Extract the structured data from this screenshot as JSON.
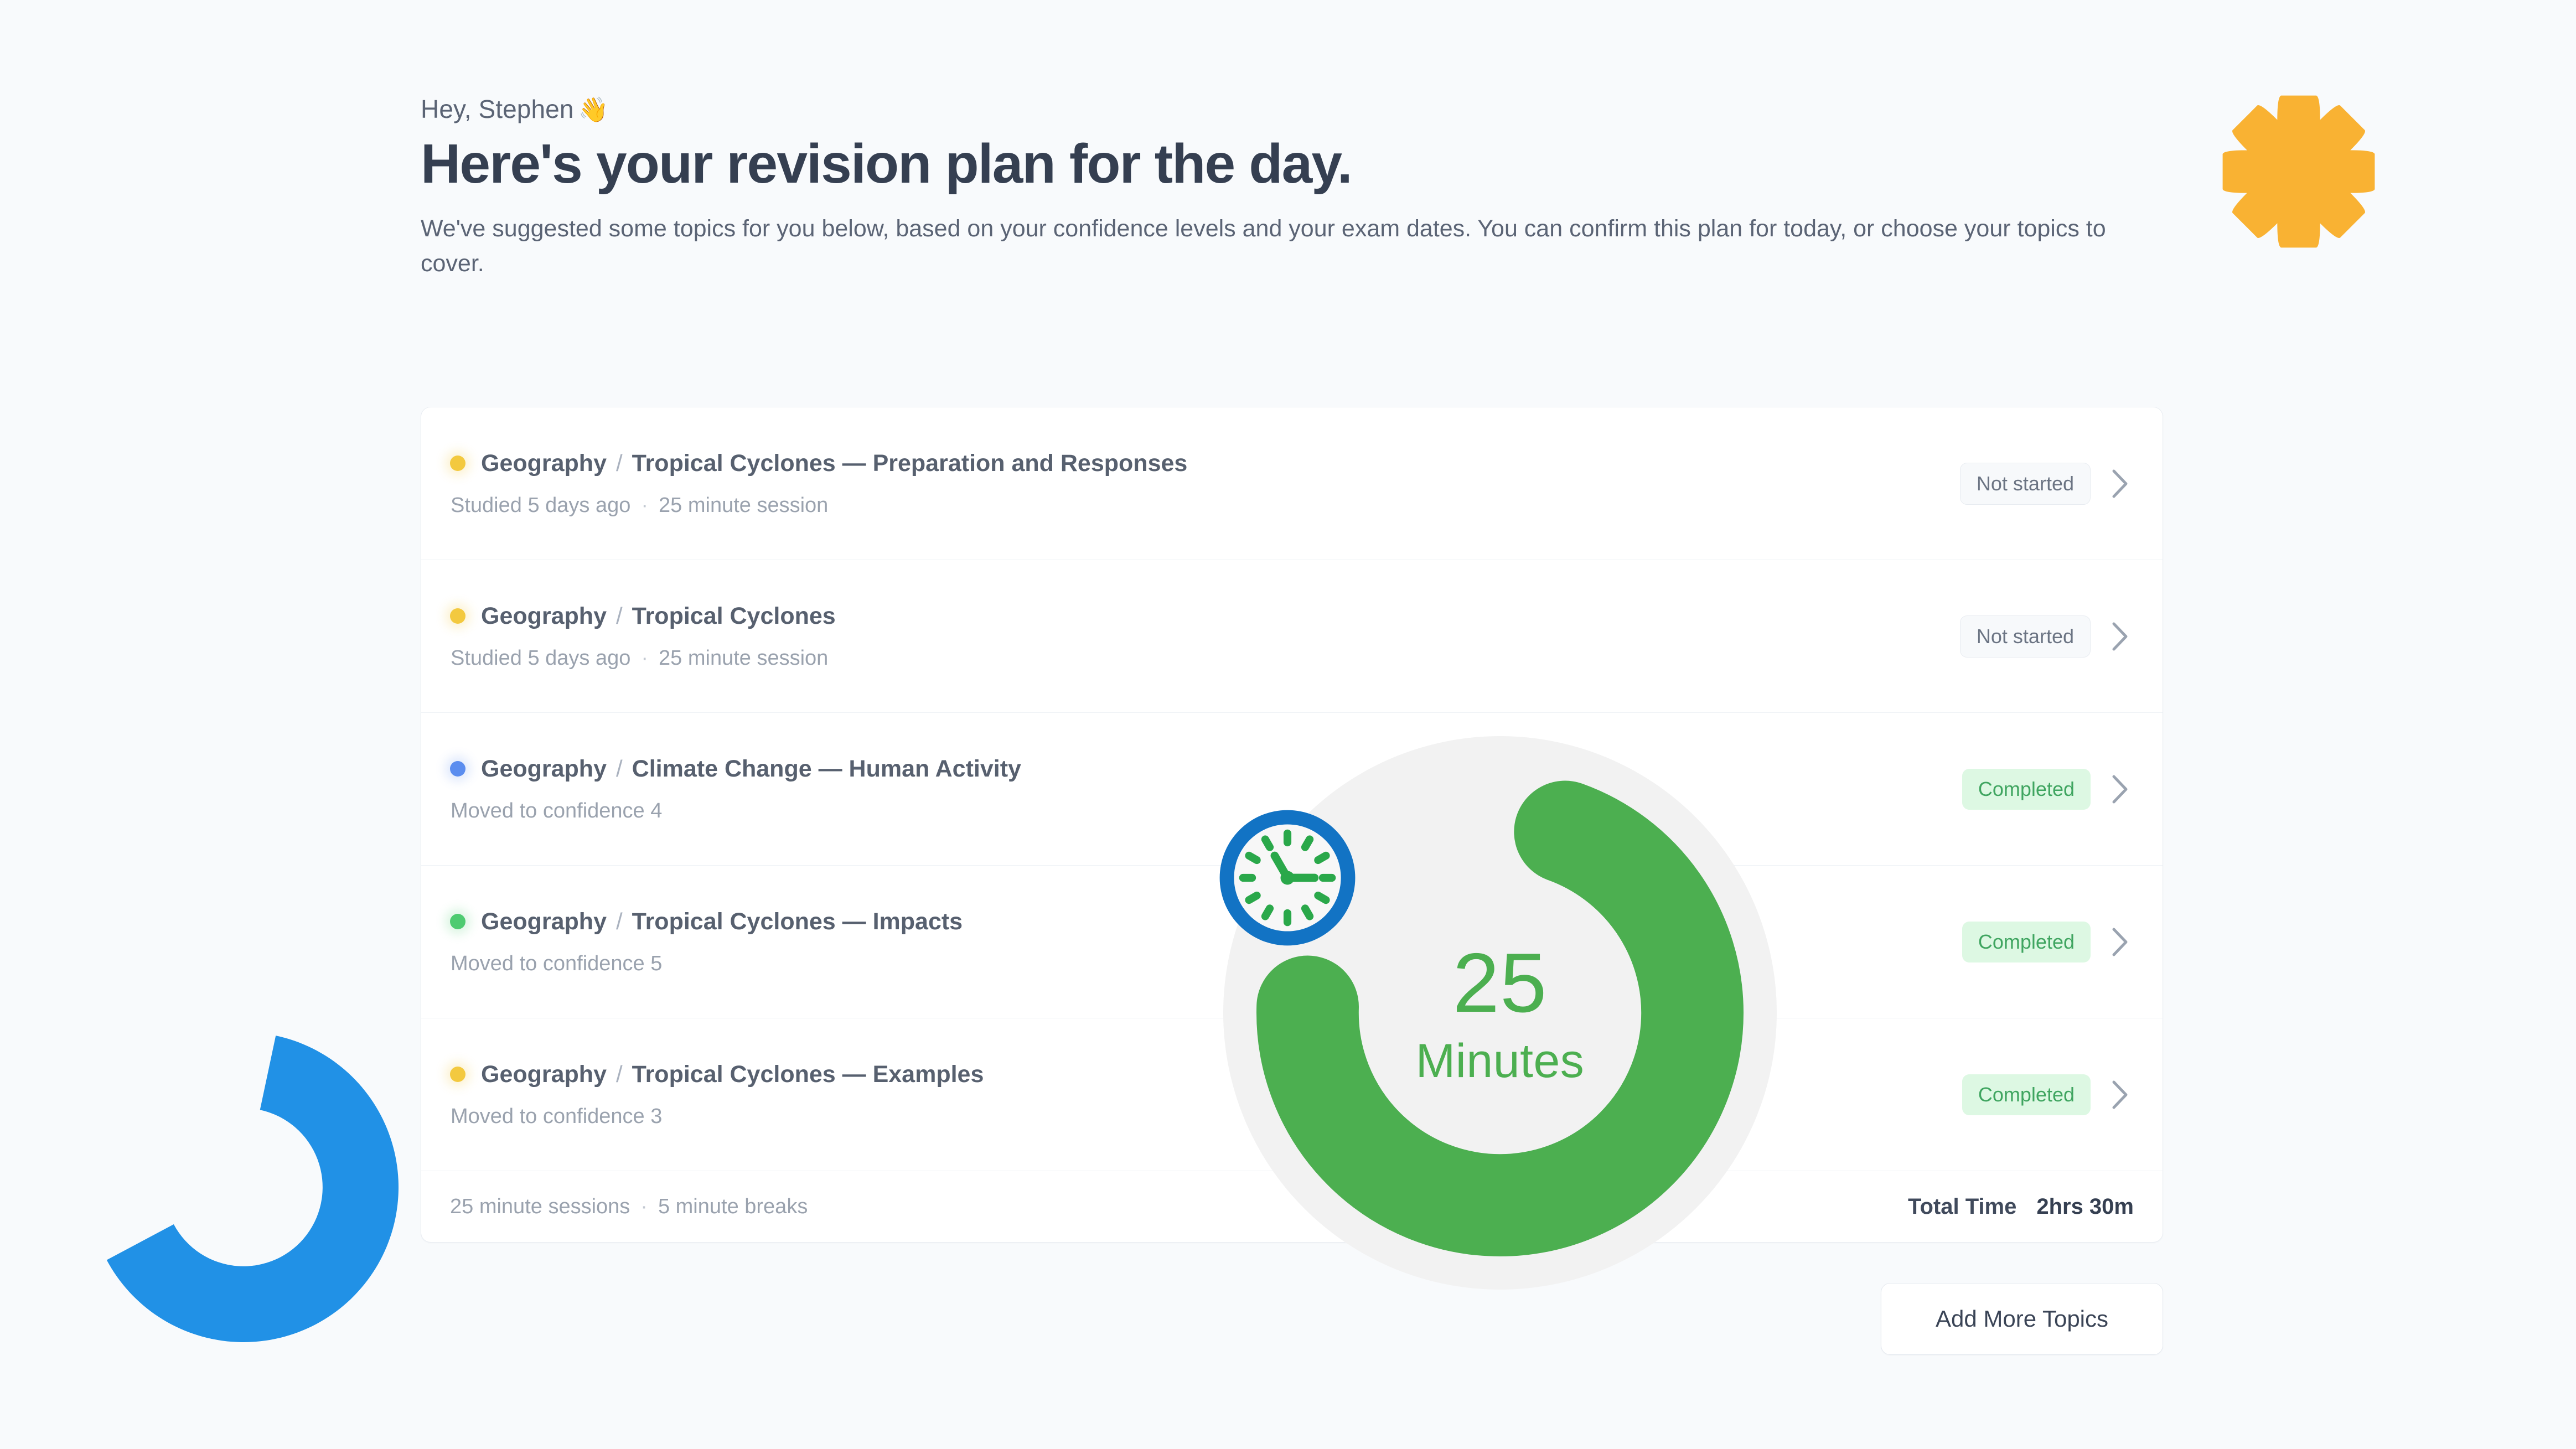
{
  "greeting": {
    "text": "Hey, Stephen",
    "emoji": "👋"
  },
  "page_title": "Here's your revision plan for the day.",
  "intro": "We've suggested some topics for you below, based on your confidence levels and your exam dates. You can confirm this plan for today, or choose your topics to cover.",
  "separator": "/",
  "middot": "·",
  "plan_rows": [
    {
      "dot_color": "yellow",
      "subject": "Geography",
      "topic": "Tropical Cyclones — Preparation and Responses",
      "meta_left": "Studied 5 days ago",
      "meta_right": "25 minute session",
      "status": "Not started",
      "status_kind": "neutral"
    },
    {
      "dot_color": "yellow",
      "subject": "Geography",
      "topic": "Tropical Cyclones",
      "meta_left": "Studied 5 days ago",
      "meta_right": "25 minute session",
      "status": "Not started",
      "status_kind": "neutral"
    },
    {
      "dot_color": "blue",
      "subject": "Geography",
      "topic": "Climate Change — Human Activity",
      "meta_left": "Moved to confidence 4",
      "meta_right": "",
      "status": "Completed",
      "status_kind": "success"
    },
    {
      "dot_color": "green",
      "subject": "Geography",
      "topic": "Tropical Cyclones — Impacts",
      "meta_left": "Moved to confidence 5",
      "meta_right": "",
      "status": "Completed",
      "status_kind": "success"
    },
    {
      "dot_color": "yellow",
      "subject": "Geography",
      "topic": "Tropical Cyclones — Examples",
      "meta_left": "Moved to confidence 3",
      "meta_right": "",
      "status": "Completed",
      "status_kind": "success"
    }
  ],
  "footer": {
    "sessions_label": "25 minute sessions",
    "breaks_label": "5 minute breaks",
    "total_time_label": "Total Time",
    "total_time_value": "2hrs 30m"
  },
  "add_topics_label": "Add More Topics",
  "timer": {
    "number": "25",
    "unit": "Minutes",
    "ring_color": "#4caf50",
    "track_color": "#f2f2f2",
    "clock_ring_color": "#1273c4",
    "clock_hand_color": "#2aa84a"
  },
  "decor": {
    "gear_color": "#f9b233",
    "arc_color": "#2191e6"
  },
  "colors": {
    "page_background": "#f8fafc",
    "card_background": "#ffffff",
    "heading": "#353f51",
    "body_text": "#5b6475",
    "muted_text": "#9aa2ae",
    "dot_yellow": "#f3c93f",
    "dot_blue": "#5b8def",
    "dot_green": "#4ecb71",
    "badge_success_bg": "#ddf8e3",
    "badge_success_fg": "#3fa560"
  }
}
